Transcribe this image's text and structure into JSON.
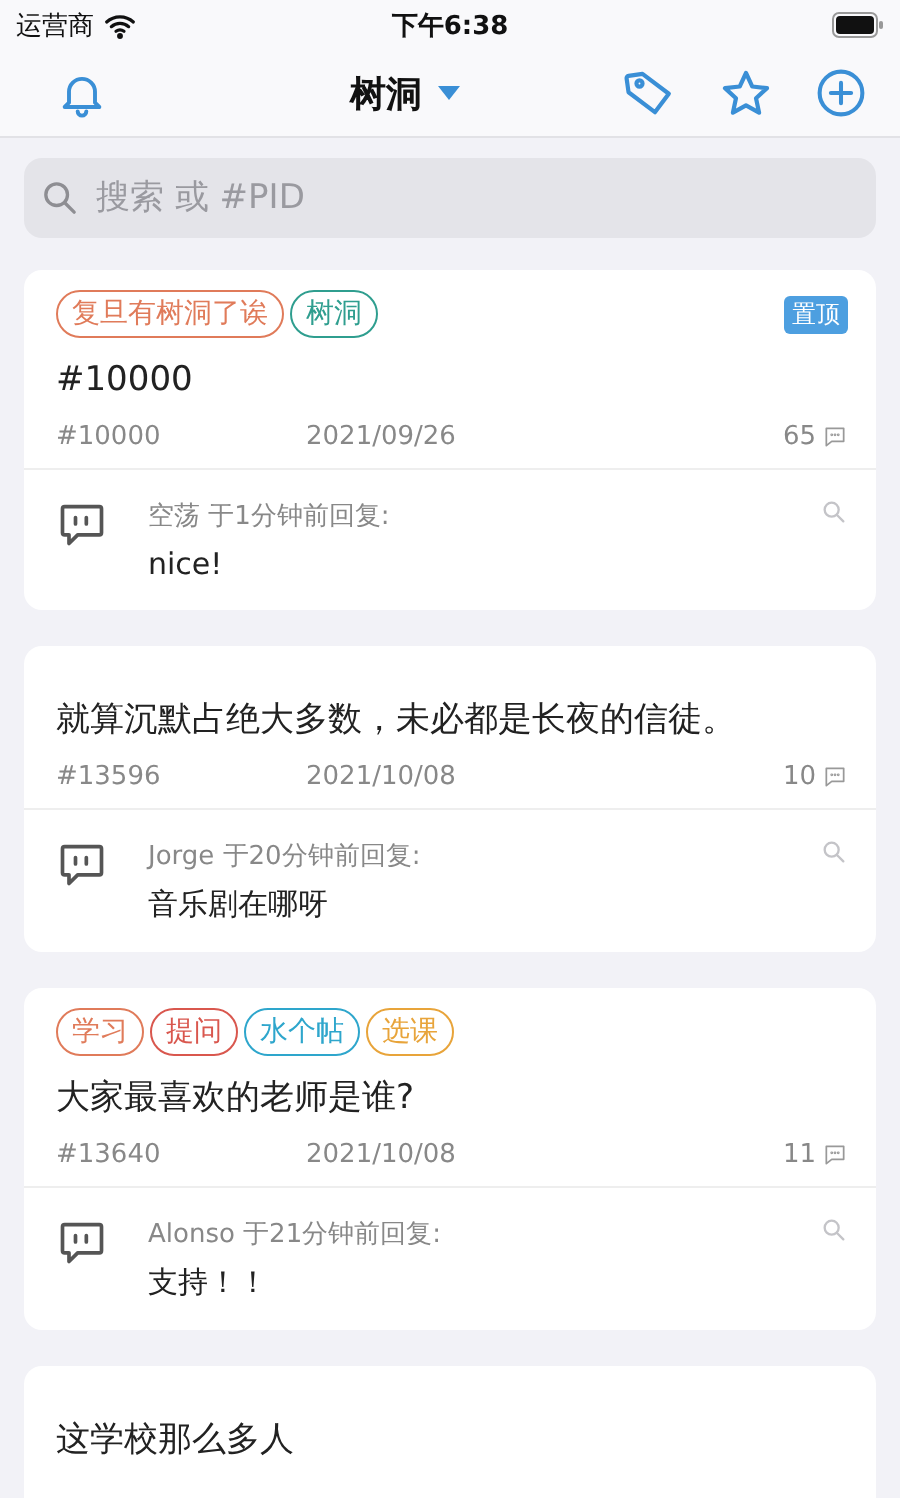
{
  "status_bar": {
    "carrier": "运营商",
    "time": "下午6:38"
  },
  "nav": {
    "title": "树洞"
  },
  "search": {
    "placeholder": "搜索 或 #PID"
  },
  "posts": [
    {
      "tags": [
        {
          "label": "复旦有树洞了诶",
          "color": "#e07b5a"
        },
        {
          "label": "树洞",
          "color": "#2f9e8f"
        }
      ],
      "pinned": true,
      "pinned_label": "置顶",
      "content": "#10000",
      "pid": "#10000",
      "date": "2021/09/26",
      "replies": "65",
      "last_reply": {
        "header": "空荡 于1分钟前回复:",
        "text": "nice!"
      }
    },
    {
      "pinned": false,
      "content": "就算沉默占绝大多数，未必都是长夜的信徒。",
      "pid": "#13596",
      "date": "2021/10/08",
      "replies": "10",
      "last_reply": {
        "header": "Jorge 于20分钟前回复:",
        "text": "音乐剧在哪呀"
      }
    },
    {
      "tags": [
        {
          "label": "学习",
          "color": "#e07b5a"
        },
        {
          "label": "提问",
          "color": "#d9574e"
        },
        {
          "label": "水个帖",
          "color": "#2ea6cc"
        },
        {
          "label": "选课",
          "color": "#e8a43a"
        }
      ],
      "pinned": false,
      "content": "大家最喜欢的老师是谁?",
      "pid": "#13640",
      "date": "2021/10/08",
      "replies": "11",
      "last_reply": {
        "header": "Alonso 于21分钟前回复:",
        "text": "支持！！"
      }
    },
    {
      "pinned": false,
      "content": "这学校那么多人"
    }
  ]
}
